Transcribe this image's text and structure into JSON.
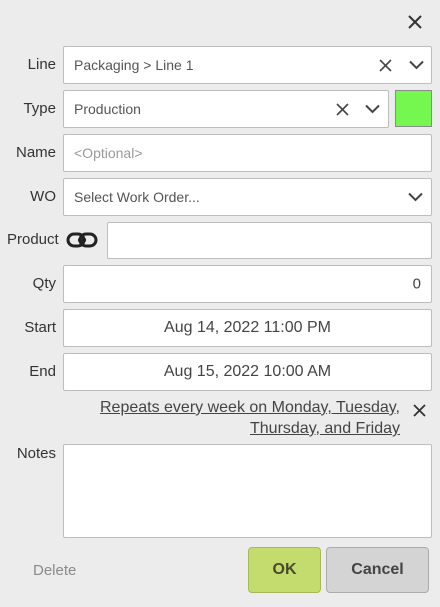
{
  "dialog": {
    "close_icon": "close-icon"
  },
  "fields": {
    "line": {
      "label": "Line",
      "value": "Packaging > Line 1"
    },
    "type": {
      "label": "Type",
      "value": "Production",
      "color": "#75f74f"
    },
    "name": {
      "label": "Name",
      "placeholder": "<Optional>"
    },
    "wo": {
      "label": "WO",
      "placeholder": "Select Work Order..."
    },
    "product": {
      "label": "Product",
      "link_icon": "link-icon",
      "value": ""
    },
    "qty": {
      "label": "Qty",
      "value": "0"
    },
    "start": {
      "label": "Start",
      "value": "Aug 14, 2022 11:00 PM"
    },
    "end": {
      "label": "End",
      "value": "Aug 15, 2022 10:00 AM"
    },
    "repeat": {
      "line1": "Repeats every week on Monday, Tuesday,",
      "line2": "Thursday, and Friday"
    },
    "notes": {
      "label": "Notes",
      "value": ""
    }
  },
  "footer": {
    "delete_label": "Delete",
    "ok_label": "OK",
    "cancel_label": "Cancel"
  }
}
